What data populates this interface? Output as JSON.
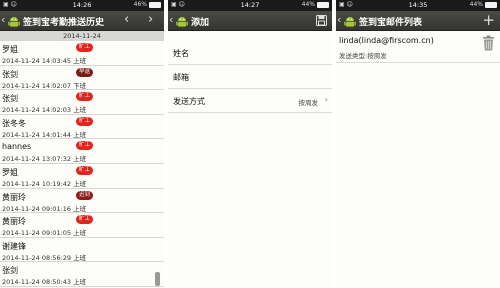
{
  "panel1": {
    "status_time": "14:26",
    "status_signal": "46%",
    "title": "签到宝考勤推送历史",
    "prev": "‹",
    "next": "›",
    "date": "2014-11-24",
    "records": [
      {
        "name": "罗姐",
        "datetime": "2014-11-24 14:03:45 上班",
        "badge": "旷工",
        "badge_color": "#e0251e"
      },
      {
        "name": "张剑",
        "datetime": "2014-11-24 14:02:07 下班",
        "badge": "早退",
        "badge_color": "#7a1d18"
      },
      {
        "name": "张剑",
        "datetime": "2014-11-24 14:02:03 上班",
        "badge": "旷工",
        "badge_color": "#e0251e"
      },
      {
        "name": "张冬冬",
        "datetime": "2014-11-24 14:01:44 上班",
        "badge": "旷工",
        "badge_color": "#e0251e"
      },
      {
        "name": "hannes",
        "datetime": "2014-11-24 13:07:32 上班",
        "badge": "旷工",
        "badge_color": "#e0251e"
      },
      {
        "name": "罗姐",
        "datetime": "2014-11-24 10:19:42 上班",
        "badge": "旷工",
        "badge_color": "#e0251e"
      },
      {
        "name": "黄丽玲",
        "datetime": "2014-11-24 09:01:16 上班",
        "badge": "迟到",
        "badge_color": "#8e1b17"
      },
      {
        "name": "黄丽玲",
        "datetime": "2014-11-24 09:01:05 上班",
        "badge": "旷工",
        "badge_color": "#e0251e"
      },
      {
        "name": "谢建锋",
        "datetime": "2014-11-24 08:56:29 上班",
        "badge": "",
        "badge_color": ""
      },
      {
        "name": "张剑",
        "datetime": "2014-11-24 08:50:43 上班",
        "badge": "",
        "badge_color": ""
      }
    ]
  },
  "panel2": {
    "status_time": "14:27",
    "status_signal": "44%",
    "title": "添加",
    "fields": [
      {
        "label": "姓名",
        "value": ""
      },
      {
        "label": "邮箱",
        "value": ""
      },
      {
        "label": "发送方式",
        "value": "按周发"
      }
    ]
  },
  "panel3": {
    "status_time": "14:35",
    "status_signal": "44%",
    "title": "签到宝邮件列表",
    "add": "+",
    "items": [
      {
        "address": "linda(linda@firscom.cn)",
        "type": "发送类型:按周发"
      }
    ]
  },
  "icons": {
    "logo": "android-logo-icon",
    "save": "save-disk-icon",
    "trash": "trash-can-icon"
  },
  "colors": {
    "titlebar": "#3e3e3a",
    "late_badge": "#8e1b17",
    "absent_badge": "#e0251e",
    "early_badge": "#7a1d18"
  }
}
